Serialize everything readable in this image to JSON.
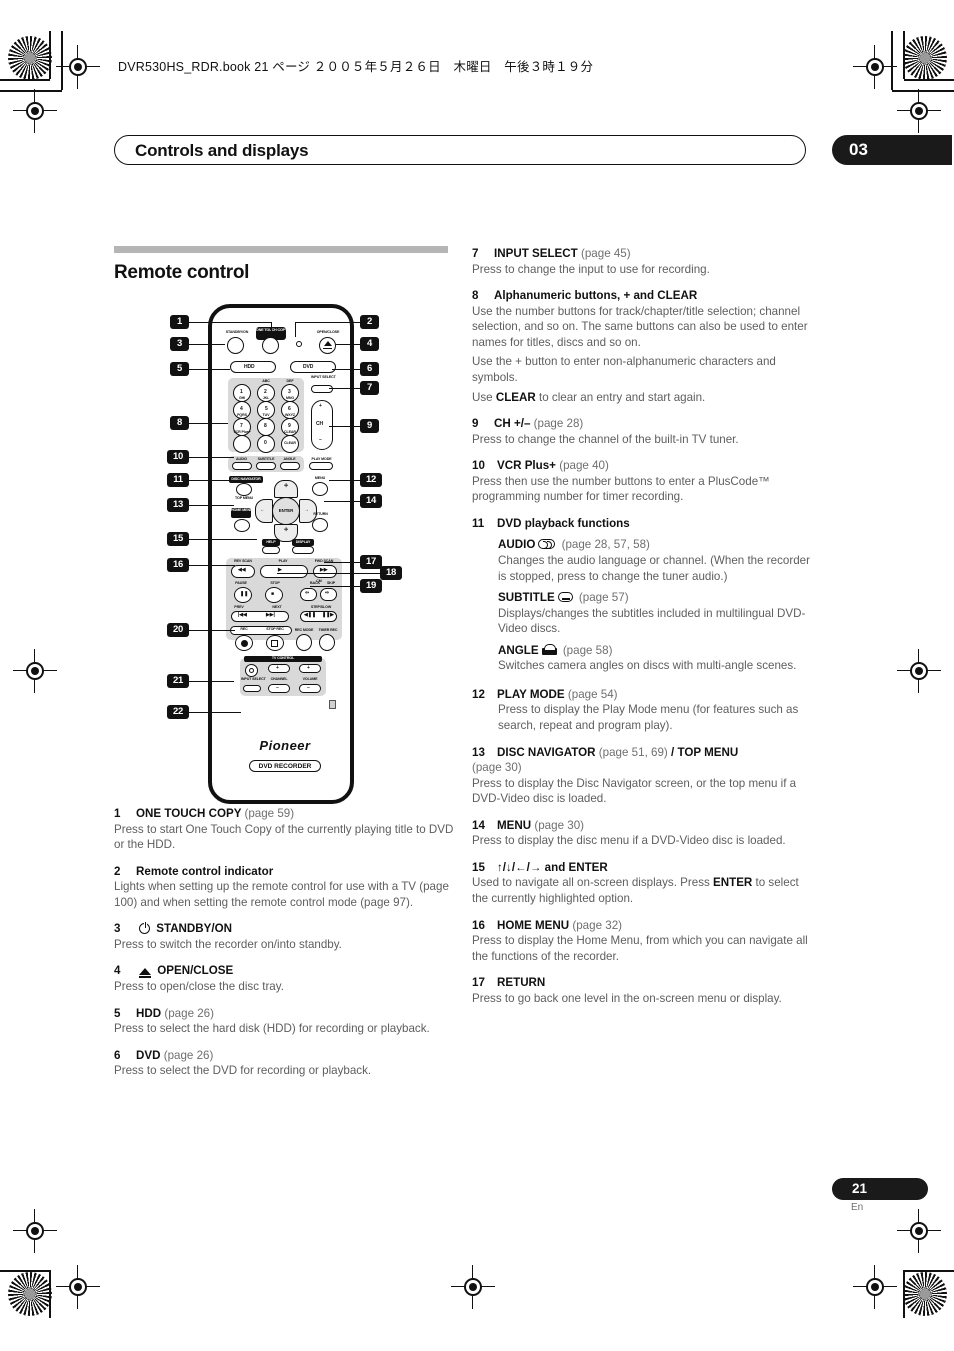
{
  "header": {
    "file_line": "DVR530HS_RDR.book  21 ページ  ２００５年５月２６日　木曜日　午後３時１９分",
    "chapter_title": "Controls and displays",
    "chapter_number": "03"
  },
  "footer": {
    "page_number": "21",
    "language_code": "En"
  },
  "section": {
    "heading": "Remote control"
  },
  "figure": {
    "brand": "Pioneer",
    "model_tag": "DVD RECORDER",
    "callouts": [
      "1",
      "2",
      "3",
      "4",
      "5",
      "6",
      "7",
      "8",
      "9",
      "10",
      "11",
      "12",
      "13",
      "14",
      "15",
      "16",
      "17",
      "18",
      "19",
      "20",
      "21",
      "22"
    ],
    "button_labels": {
      "standby": "STANDBY/ON",
      "one_touch_copy": "ONE TOUCH COPY",
      "open_close": "OPEN/CLOSE",
      "hdd": "HDD",
      "dvd": "DVD",
      "input_select": "INPUT SELECT",
      "ch": "CH",
      "ch_plus": "+",
      "ch_minus": "–",
      "vcr_plus": "VCR Plus+",
      "clear": "CLEAR",
      "audio": "AUDIO",
      "subtitle": "SUBTITLE",
      "angle": "ANGLE",
      "play_mode": "PLAY MODE",
      "disc_navigator": "DISC NAVIGATOR",
      "top_menu": "TOP MENU",
      "menu": "MENU",
      "home_menu": "HOME MENU",
      "enter": "ENTER",
      "return": "RETURN",
      "help": "HELP",
      "display": "DISPLAY",
      "rev_scan": "REV SCAN",
      "play": "PLAY",
      "fwd_scan": "FWD SCAN",
      "pause": "PAUSE",
      "stop": "STOP",
      "back": "BACK",
      "cm": "CM",
      "skip": "SKIP",
      "prev": "PREV",
      "next": "NEXT",
      "step_slow": "STEP/SLOW",
      "rec": "REC",
      "stop_rec": "STOP REC",
      "rec_mode": "REC MODE",
      "timer_rec": "TIMER REC",
      "tv_control": "TV CONTROL",
      "tv_input_select": "INPUT SELECT",
      "channel": "CHANNEL",
      "volume": "VOLUME"
    },
    "keypad": [
      {
        "digit": "1",
        "letters": ""
      },
      {
        "digit": "2",
        "letters": "ABC"
      },
      {
        "digit": "3",
        "letters": "DEF"
      },
      {
        "digit": "4",
        "letters": "GHI"
      },
      {
        "digit": "5",
        "letters": "JKL"
      },
      {
        "digit": "6",
        "letters": "MNO"
      },
      {
        "digit": "7",
        "letters": "PQRS"
      },
      {
        "digit": "8",
        "letters": "TUV"
      },
      {
        "digit": "9",
        "letters": "WXYZ"
      },
      {
        "digit": "0",
        "letters": ""
      }
    ]
  },
  "left_items": [
    {
      "num": "1",
      "title": "ONE TOUCH COPY",
      "page": "(page 59)",
      "body": "Press to start One Touch Copy of the currently playing title to DVD or the HDD."
    },
    {
      "num": "2",
      "title": "Remote control indicator",
      "page": "",
      "body": "Lights when setting up the remote control for use with a TV (page 100) and when setting the remote control mode (page 97)."
    },
    {
      "num": "3",
      "title": "STANDBY/ON",
      "page": "",
      "body": "Press to switch the recorder on/into standby."
    },
    {
      "num": "4",
      "title": "OPEN/CLOSE",
      "page": "",
      "body": "Press to open/close the disc tray."
    },
    {
      "num": "5",
      "title": "HDD",
      "page": "(page 26)",
      "body": "Press to select the hard disk (HDD) for recording or playback."
    },
    {
      "num": "6",
      "title": "DVD",
      "page": "(page 26)",
      "body": "Press to select the DVD for recording or playback."
    }
  ],
  "right_items": {
    "item7": {
      "num": "7",
      "title": "INPUT SELECT",
      "page": "(page 45)",
      "body": "Press to change the input to use for recording."
    },
    "item8": {
      "num": "8",
      "title": "Alphanumeric buttons, + and CLEAR",
      "body1": "Use the number buttons for track/chapter/title selection; channel selection, and so on. The same buttons can also be used to enter names for titles, discs and so on.",
      "body2": "Use the + button to enter non-alphanumeric characters and symbols.",
      "body3_pre": "Use ",
      "body3_bold": "CLEAR",
      "body3_post": " to clear an entry and start again."
    },
    "item9": {
      "num": "9",
      "title": "CH +/–",
      "page": "(page 28)",
      "body": "Press to change the channel of the built-in TV tuner."
    },
    "item10": {
      "num": "10",
      "title": "VCR Plus+",
      "page": "(page 40)",
      "body": "Press then use the number buttons to enter a PlusCode™ programming number for timer recording."
    },
    "item11": {
      "num": "11",
      "title": "DVD playback functions",
      "audio": {
        "label": "AUDIO",
        "page": "(page 28, 57, 58)",
        "body": "Changes the audio language or channel. (When the recorder is stopped, press to change the tuner audio.)"
      },
      "subtitle": {
        "label": "SUBTITLE",
        "page": "(page 57)",
        "body": "Displays/changes the subtitles included in multilingual DVD-Video discs."
      },
      "angle": {
        "label": "ANGLE",
        "page": "(page 58)",
        "body": "Switches camera angles on discs with multi-angle scenes."
      }
    },
    "item12": {
      "num": "12",
      "title": "PLAY MODE",
      "page": "(page 54)",
      "body": "Press to display the Play Mode menu (for features such as search, repeat and program play)."
    },
    "item13": {
      "num": "13",
      "title": "DISC NAVIGATOR",
      "page": "(page 51, 69)",
      "title2": "/ TOP MENU",
      "page2": "(page 30)",
      "body": "Press to display the Disc Navigator screen, or the top menu if a DVD-Video disc is loaded."
    },
    "item14": {
      "num": "14",
      "title": "MENU",
      "page": "(page 30)",
      "body": "Press to display the disc menu if a DVD-Video disc is loaded."
    },
    "item15": {
      "num": "15",
      "title": "↑/↓/←/→ and ENTER",
      "body_pre": "Used to navigate all on-screen displays. Press ",
      "body_bold": "ENTER",
      "body_post": " to select the currently highlighted option."
    },
    "item16": {
      "num": "16",
      "title": "HOME MENU",
      "page": "(page 32)",
      "body": "Press to display the Home Menu, from which you can navigate all the functions of the recorder."
    },
    "item17": {
      "num": "17",
      "title": "RETURN",
      "page": "",
      "body": "Press to go back one level in the on-screen menu or display."
    }
  }
}
